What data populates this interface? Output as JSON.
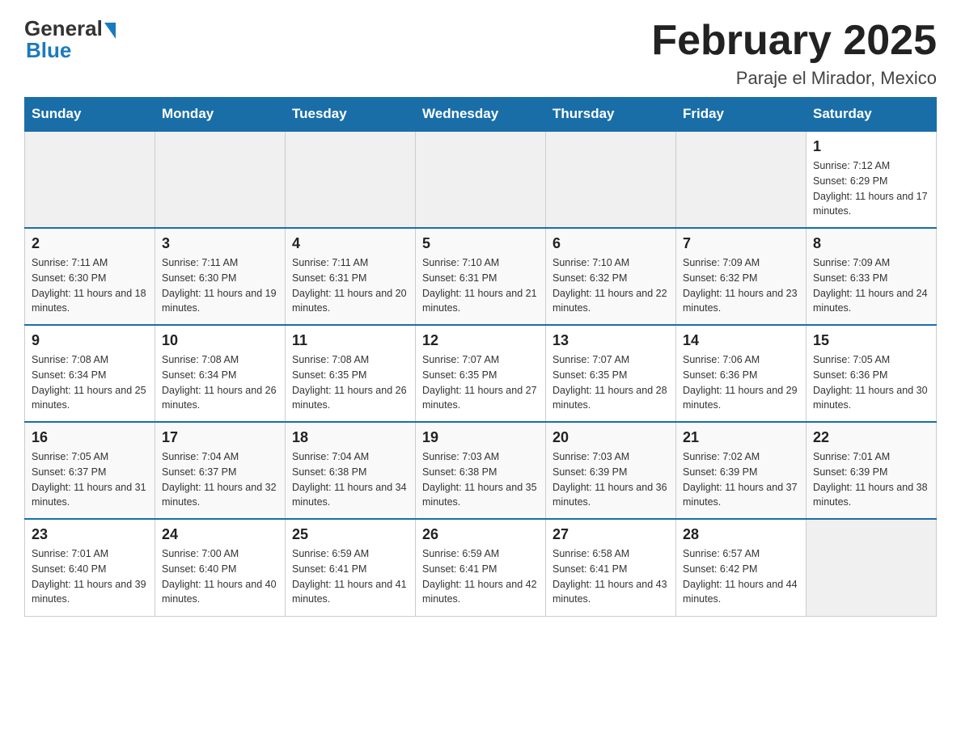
{
  "logo": {
    "general": "General",
    "blue": "Blue"
  },
  "title": "February 2025",
  "subtitle": "Paraje el Mirador, Mexico",
  "days_of_week": [
    "Sunday",
    "Monday",
    "Tuesday",
    "Wednesday",
    "Thursday",
    "Friday",
    "Saturday"
  ],
  "weeks": [
    [
      {
        "day": "",
        "info": ""
      },
      {
        "day": "",
        "info": ""
      },
      {
        "day": "",
        "info": ""
      },
      {
        "day": "",
        "info": ""
      },
      {
        "day": "",
        "info": ""
      },
      {
        "day": "",
        "info": ""
      },
      {
        "day": "1",
        "info": "Sunrise: 7:12 AM\nSunset: 6:29 PM\nDaylight: 11 hours and 17 minutes."
      }
    ],
    [
      {
        "day": "2",
        "info": "Sunrise: 7:11 AM\nSunset: 6:30 PM\nDaylight: 11 hours and 18 minutes."
      },
      {
        "day": "3",
        "info": "Sunrise: 7:11 AM\nSunset: 6:30 PM\nDaylight: 11 hours and 19 minutes."
      },
      {
        "day": "4",
        "info": "Sunrise: 7:11 AM\nSunset: 6:31 PM\nDaylight: 11 hours and 20 minutes."
      },
      {
        "day": "5",
        "info": "Sunrise: 7:10 AM\nSunset: 6:31 PM\nDaylight: 11 hours and 21 minutes."
      },
      {
        "day": "6",
        "info": "Sunrise: 7:10 AM\nSunset: 6:32 PM\nDaylight: 11 hours and 22 minutes."
      },
      {
        "day": "7",
        "info": "Sunrise: 7:09 AM\nSunset: 6:32 PM\nDaylight: 11 hours and 23 minutes."
      },
      {
        "day": "8",
        "info": "Sunrise: 7:09 AM\nSunset: 6:33 PM\nDaylight: 11 hours and 24 minutes."
      }
    ],
    [
      {
        "day": "9",
        "info": "Sunrise: 7:08 AM\nSunset: 6:34 PM\nDaylight: 11 hours and 25 minutes."
      },
      {
        "day": "10",
        "info": "Sunrise: 7:08 AM\nSunset: 6:34 PM\nDaylight: 11 hours and 26 minutes."
      },
      {
        "day": "11",
        "info": "Sunrise: 7:08 AM\nSunset: 6:35 PM\nDaylight: 11 hours and 26 minutes."
      },
      {
        "day": "12",
        "info": "Sunrise: 7:07 AM\nSunset: 6:35 PM\nDaylight: 11 hours and 27 minutes."
      },
      {
        "day": "13",
        "info": "Sunrise: 7:07 AM\nSunset: 6:35 PM\nDaylight: 11 hours and 28 minutes."
      },
      {
        "day": "14",
        "info": "Sunrise: 7:06 AM\nSunset: 6:36 PM\nDaylight: 11 hours and 29 minutes."
      },
      {
        "day": "15",
        "info": "Sunrise: 7:05 AM\nSunset: 6:36 PM\nDaylight: 11 hours and 30 minutes."
      }
    ],
    [
      {
        "day": "16",
        "info": "Sunrise: 7:05 AM\nSunset: 6:37 PM\nDaylight: 11 hours and 31 minutes."
      },
      {
        "day": "17",
        "info": "Sunrise: 7:04 AM\nSunset: 6:37 PM\nDaylight: 11 hours and 32 minutes."
      },
      {
        "day": "18",
        "info": "Sunrise: 7:04 AM\nSunset: 6:38 PM\nDaylight: 11 hours and 34 minutes."
      },
      {
        "day": "19",
        "info": "Sunrise: 7:03 AM\nSunset: 6:38 PM\nDaylight: 11 hours and 35 minutes."
      },
      {
        "day": "20",
        "info": "Sunrise: 7:03 AM\nSunset: 6:39 PM\nDaylight: 11 hours and 36 minutes."
      },
      {
        "day": "21",
        "info": "Sunrise: 7:02 AM\nSunset: 6:39 PM\nDaylight: 11 hours and 37 minutes."
      },
      {
        "day": "22",
        "info": "Sunrise: 7:01 AM\nSunset: 6:39 PM\nDaylight: 11 hours and 38 minutes."
      }
    ],
    [
      {
        "day": "23",
        "info": "Sunrise: 7:01 AM\nSunset: 6:40 PM\nDaylight: 11 hours and 39 minutes."
      },
      {
        "day": "24",
        "info": "Sunrise: 7:00 AM\nSunset: 6:40 PM\nDaylight: 11 hours and 40 minutes."
      },
      {
        "day": "25",
        "info": "Sunrise: 6:59 AM\nSunset: 6:41 PM\nDaylight: 11 hours and 41 minutes."
      },
      {
        "day": "26",
        "info": "Sunrise: 6:59 AM\nSunset: 6:41 PM\nDaylight: 11 hours and 42 minutes."
      },
      {
        "day": "27",
        "info": "Sunrise: 6:58 AM\nSunset: 6:41 PM\nDaylight: 11 hours and 43 minutes."
      },
      {
        "day": "28",
        "info": "Sunrise: 6:57 AM\nSunset: 6:42 PM\nDaylight: 11 hours and 44 minutes."
      },
      {
        "day": "",
        "info": ""
      }
    ]
  ]
}
